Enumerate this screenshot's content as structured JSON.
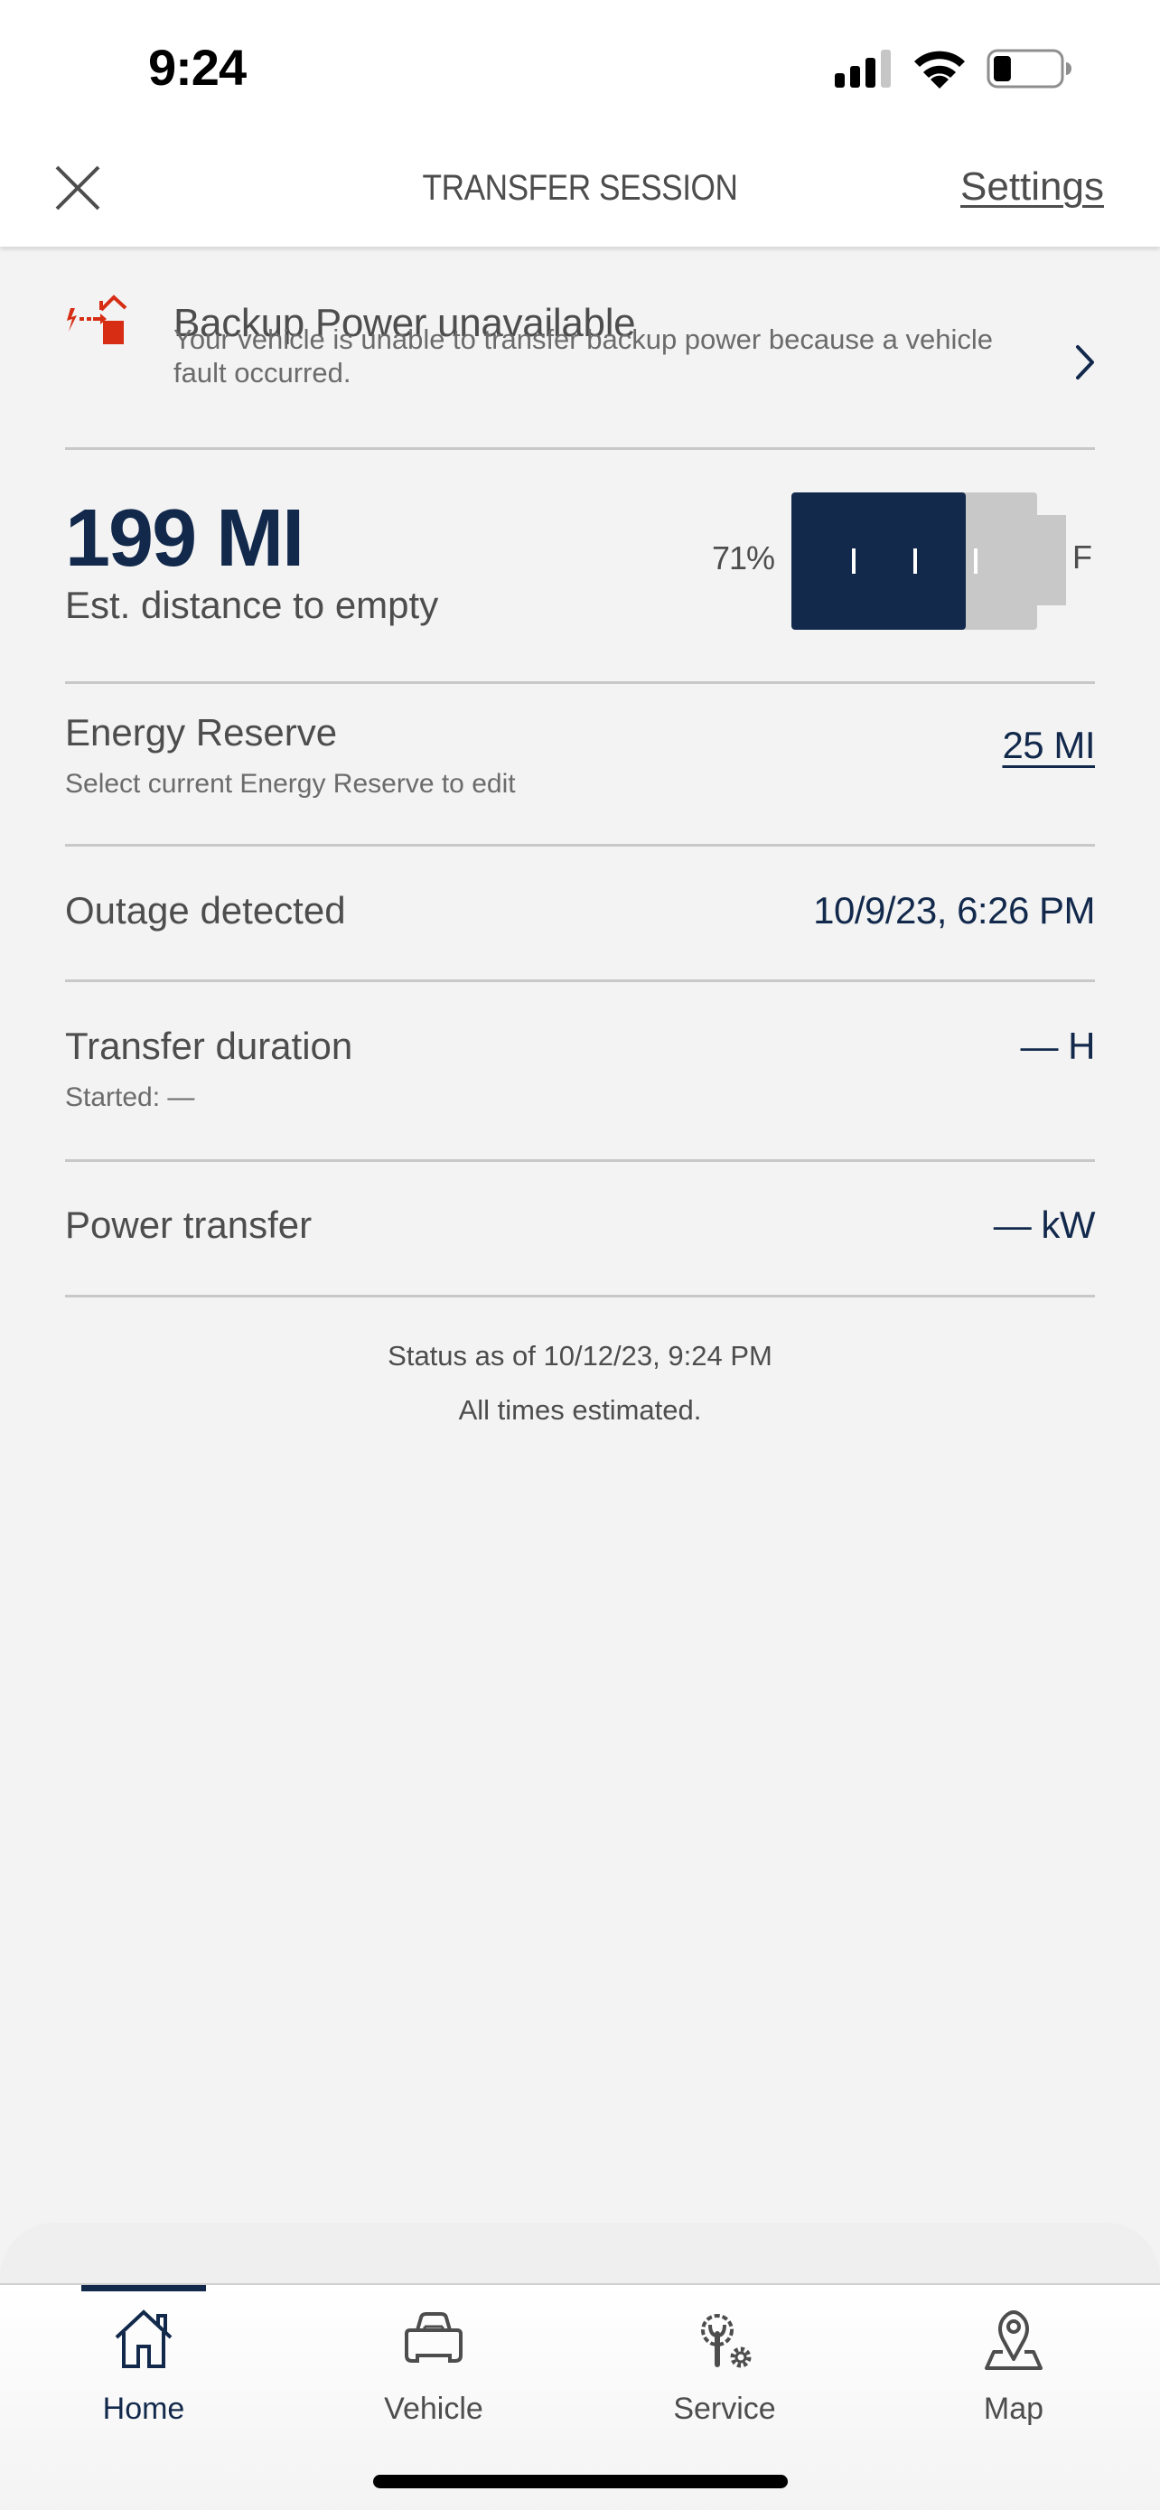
{
  "status_bar": {
    "time": "9:24",
    "signal_bars_active": 3,
    "signal_bars_total": 4,
    "battery_level": 0.27,
    "icons": [
      "cellular-signal-icon",
      "wifi-icon",
      "battery-icon"
    ]
  },
  "header": {
    "title": "TRANSFER SESSION",
    "close_icon": "close-icon",
    "settings_label": "Settings"
  },
  "alert": {
    "icon": "backup-power-unavailable-icon",
    "title": "Backup Power unavailable",
    "description": "Your vehicle is unable to transfer backup power because a vehicle fault occurred.",
    "chevron_icon": "chevron-right-icon"
  },
  "range": {
    "value": "199 MI",
    "label": "Est. distance to empty",
    "charge_percent_label": "71%",
    "charge_fraction": 0.71,
    "full_label": "F"
  },
  "rows": {
    "energy_reserve": {
      "label": "Energy Reserve",
      "sub": "Select current Energy Reserve to edit",
      "value": "25 MI"
    },
    "outage": {
      "label": "Outage detected",
      "value": "10/9/23, 6:26 PM"
    },
    "transfer_duration": {
      "label": "Transfer duration",
      "sub": "Started: —",
      "value": "— H"
    },
    "power_transfer": {
      "label": "Power transfer",
      "value": "— kW"
    }
  },
  "footer": {
    "status_as_of": "Status as of 10/12/23, 9:24 PM",
    "estimate_note": "All times estimated."
  },
  "tabbar": {
    "active_tab": "home",
    "tabs": [
      {
        "id": "home",
        "label": "Home",
        "icon": "home-icon"
      },
      {
        "id": "vehicle",
        "label": "Vehicle",
        "icon": "vehicle-icon"
      },
      {
        "id": "service",
        "label": "Service",
        "icon": "service-icon"
      },
      {
        "id": "map",
        "label": "Map",
        "icon": "map-pin-icon"
      }
    ]
  },
  "colors": {
    "brand_navy": "#12294c",
    "alert_red": "#d62d14",
    "background": "#f3f3f3",
    "divider": "#c8c8c8",
    "battery_empty": "#c8c8c8"
  }
}
